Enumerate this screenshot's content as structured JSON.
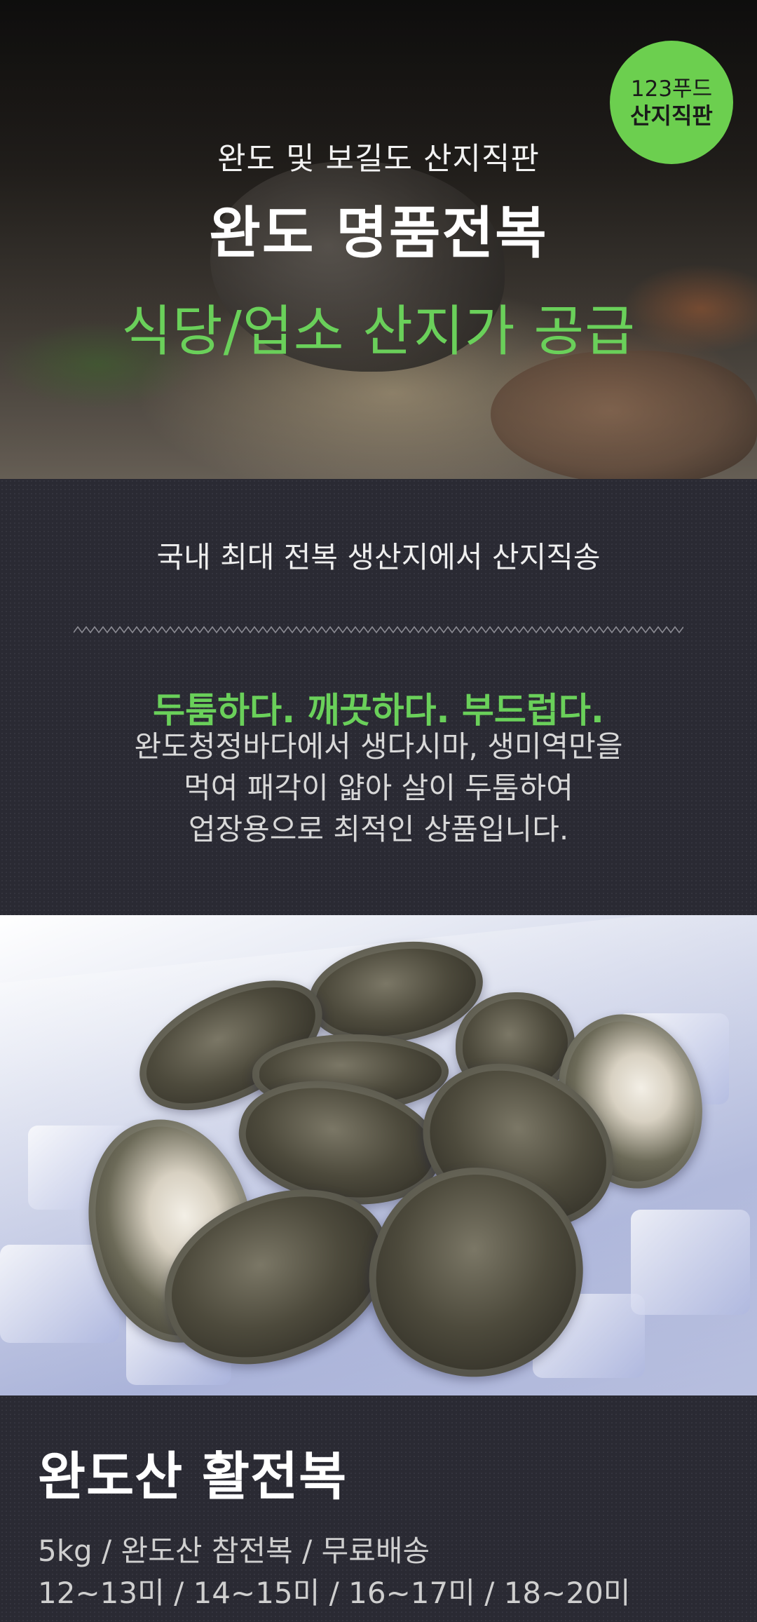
{
  "hero": {
    "subtitle": "완도 및 보길도 산지직판",
    "title": "완도 명품전복",
    "tagline": "식당/업소 산지가 공급",
    "badge": {
      "line1": "123푸드",
      "line2": "산지직판",
      "color": "#6ccf4f"
    }
  },
  "intro": {
    "headline": "국내 최대 전복 생산지에서 산지직송",
    "highlight": "두툼하다. 깨끗하다. 부드럽다.",
    "body_lines": [
      "완도청정바다에서 생다시마, 생미역만을",
      "먹여 패각이 얇아 살이 두툼하여",
      "업장용으로 최적인 상품입니다."
    ]
  },
  "product": {
    "name": "완도산 활전복",
    "details": "5kg / 완도산 참전복 / 무료배송",
    "sizes": "12~13미 / 14~15미 / 16~17미 / 18~20미"
  },
  "colors": {
    "accent_green": "#6ad05a",
    "background_dark": "#2a2a33"
  }
}
